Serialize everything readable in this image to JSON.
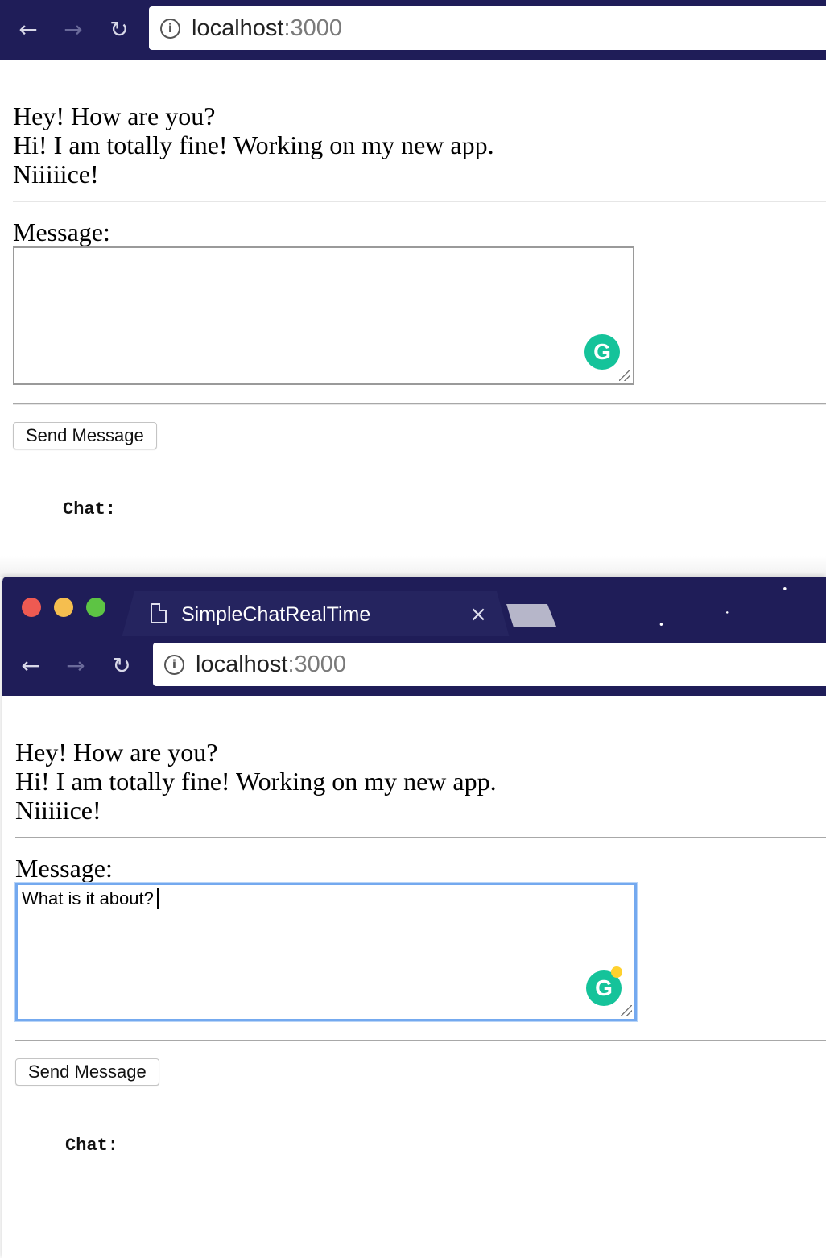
{
  "colors": {
    "chrome_bg": "#1f1d58",
    "tab_bg": "#25245f",
    "focus_ring": "#74a9ef",
    "grammarly": "#15c39a",
    "grammarly_dot": "#ffd12e"
  },
  "windows": [
    {
      "nav": {
        "back_icon": "arrow-left-icon",
        "back": "←",
        "forward_icon": "arrow-right-icon",
        "forward": "→",
        "reload_icon": "reload-icon",
        "reload": "↻"
      },
      "address": {
        "info_icon": "i",
        "host": "localhost",
        "port": ":3000"
      },
      "messages": [
        "Hey! How are you?",
        "Hi! I am totally fine! Working on my new app.",
        "Niiiiice!"
      ],
      "message_label": "Message:",
      "textarea_value": "",
      "grammarly_icon": "G",
      "send_label": "Send Message",
      "chat_label": "Chat:"
    },
    {
      "tab": {
        "title": "SimpleChatRealTime",
        "close": "×"
      },
      "nav": {
        "back_icon": "arrow-left-icon",
        "back": "←",
        "forward_icon": "arrow-right-icon",
        "forward": "→",
        "reload_icon": "reload-icon",
        "reload": "↻"
      },
      "address": {
        "info_icon": "i",
        "host": "localhost",
        "port": ":3000"
      },
      "messages": [
        "Hey! How are you?",
        "Hi! I am totally fine! Working on my new app.",
        "Niiiiice!"
      ],
      "message_label": "Message:",
      "textarea_value": "What is it about?",
      "grammarly_icon": "G",
      "send_label": "Send Message",
      "chat_label": "Chat:"
    }
  ]
}
